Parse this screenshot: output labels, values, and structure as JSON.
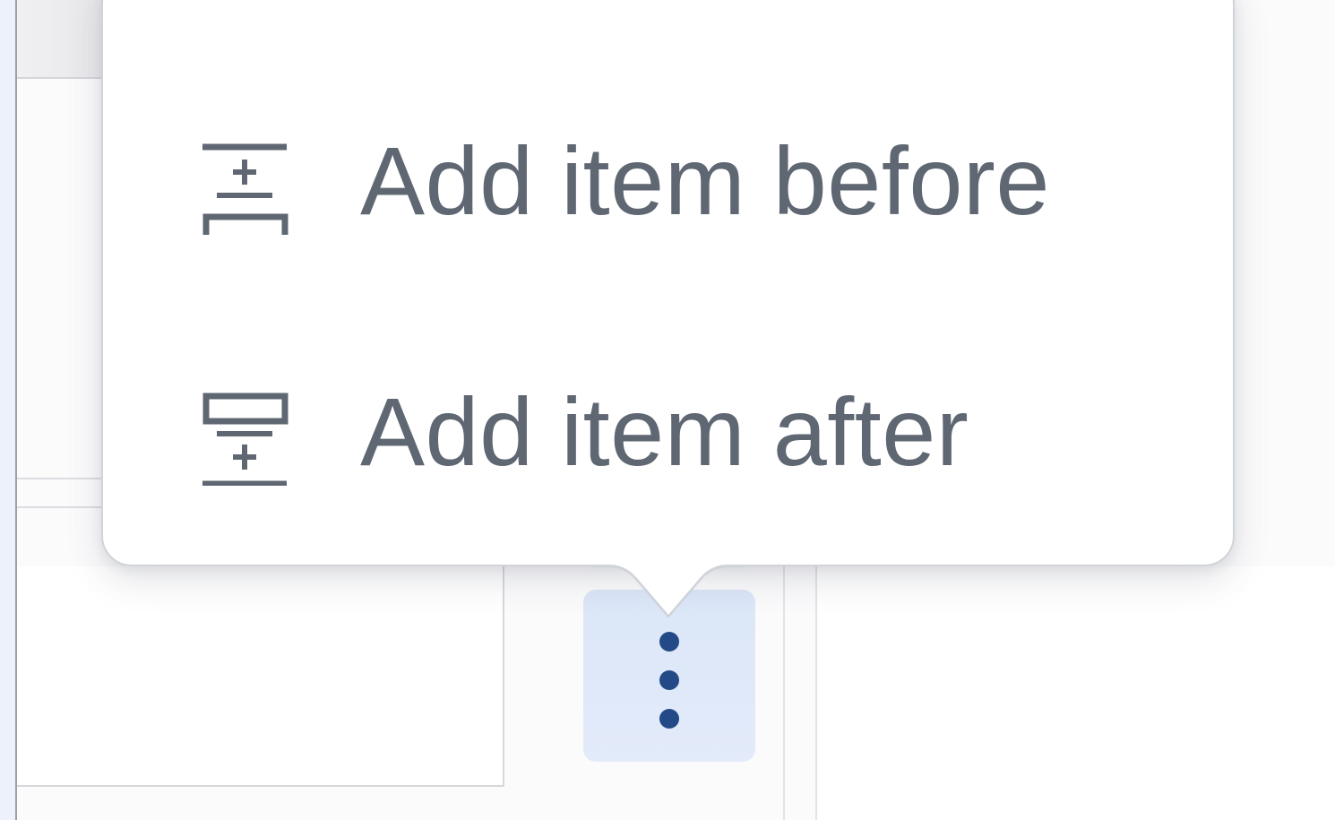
{
  "menu": {
    "items": [
      {
        "label": "Add item before",
        "icon": "insert-before-icon"
      },
      {
        "label": "Add item after",
        "icon": "insert-after-icon"
      }
    ]
  },
  "trigger": {
    "icon": "more-vertical-icon"
  },
  "colors": {
    "menu_text": "#5f6772",
    "icon_stroke": "#5f6772",
    "trigger_bg": "#dbe6f8",
    "trigger_dots": "#234a86",
    "popover_border": "#d0d3d9"
  }
}
